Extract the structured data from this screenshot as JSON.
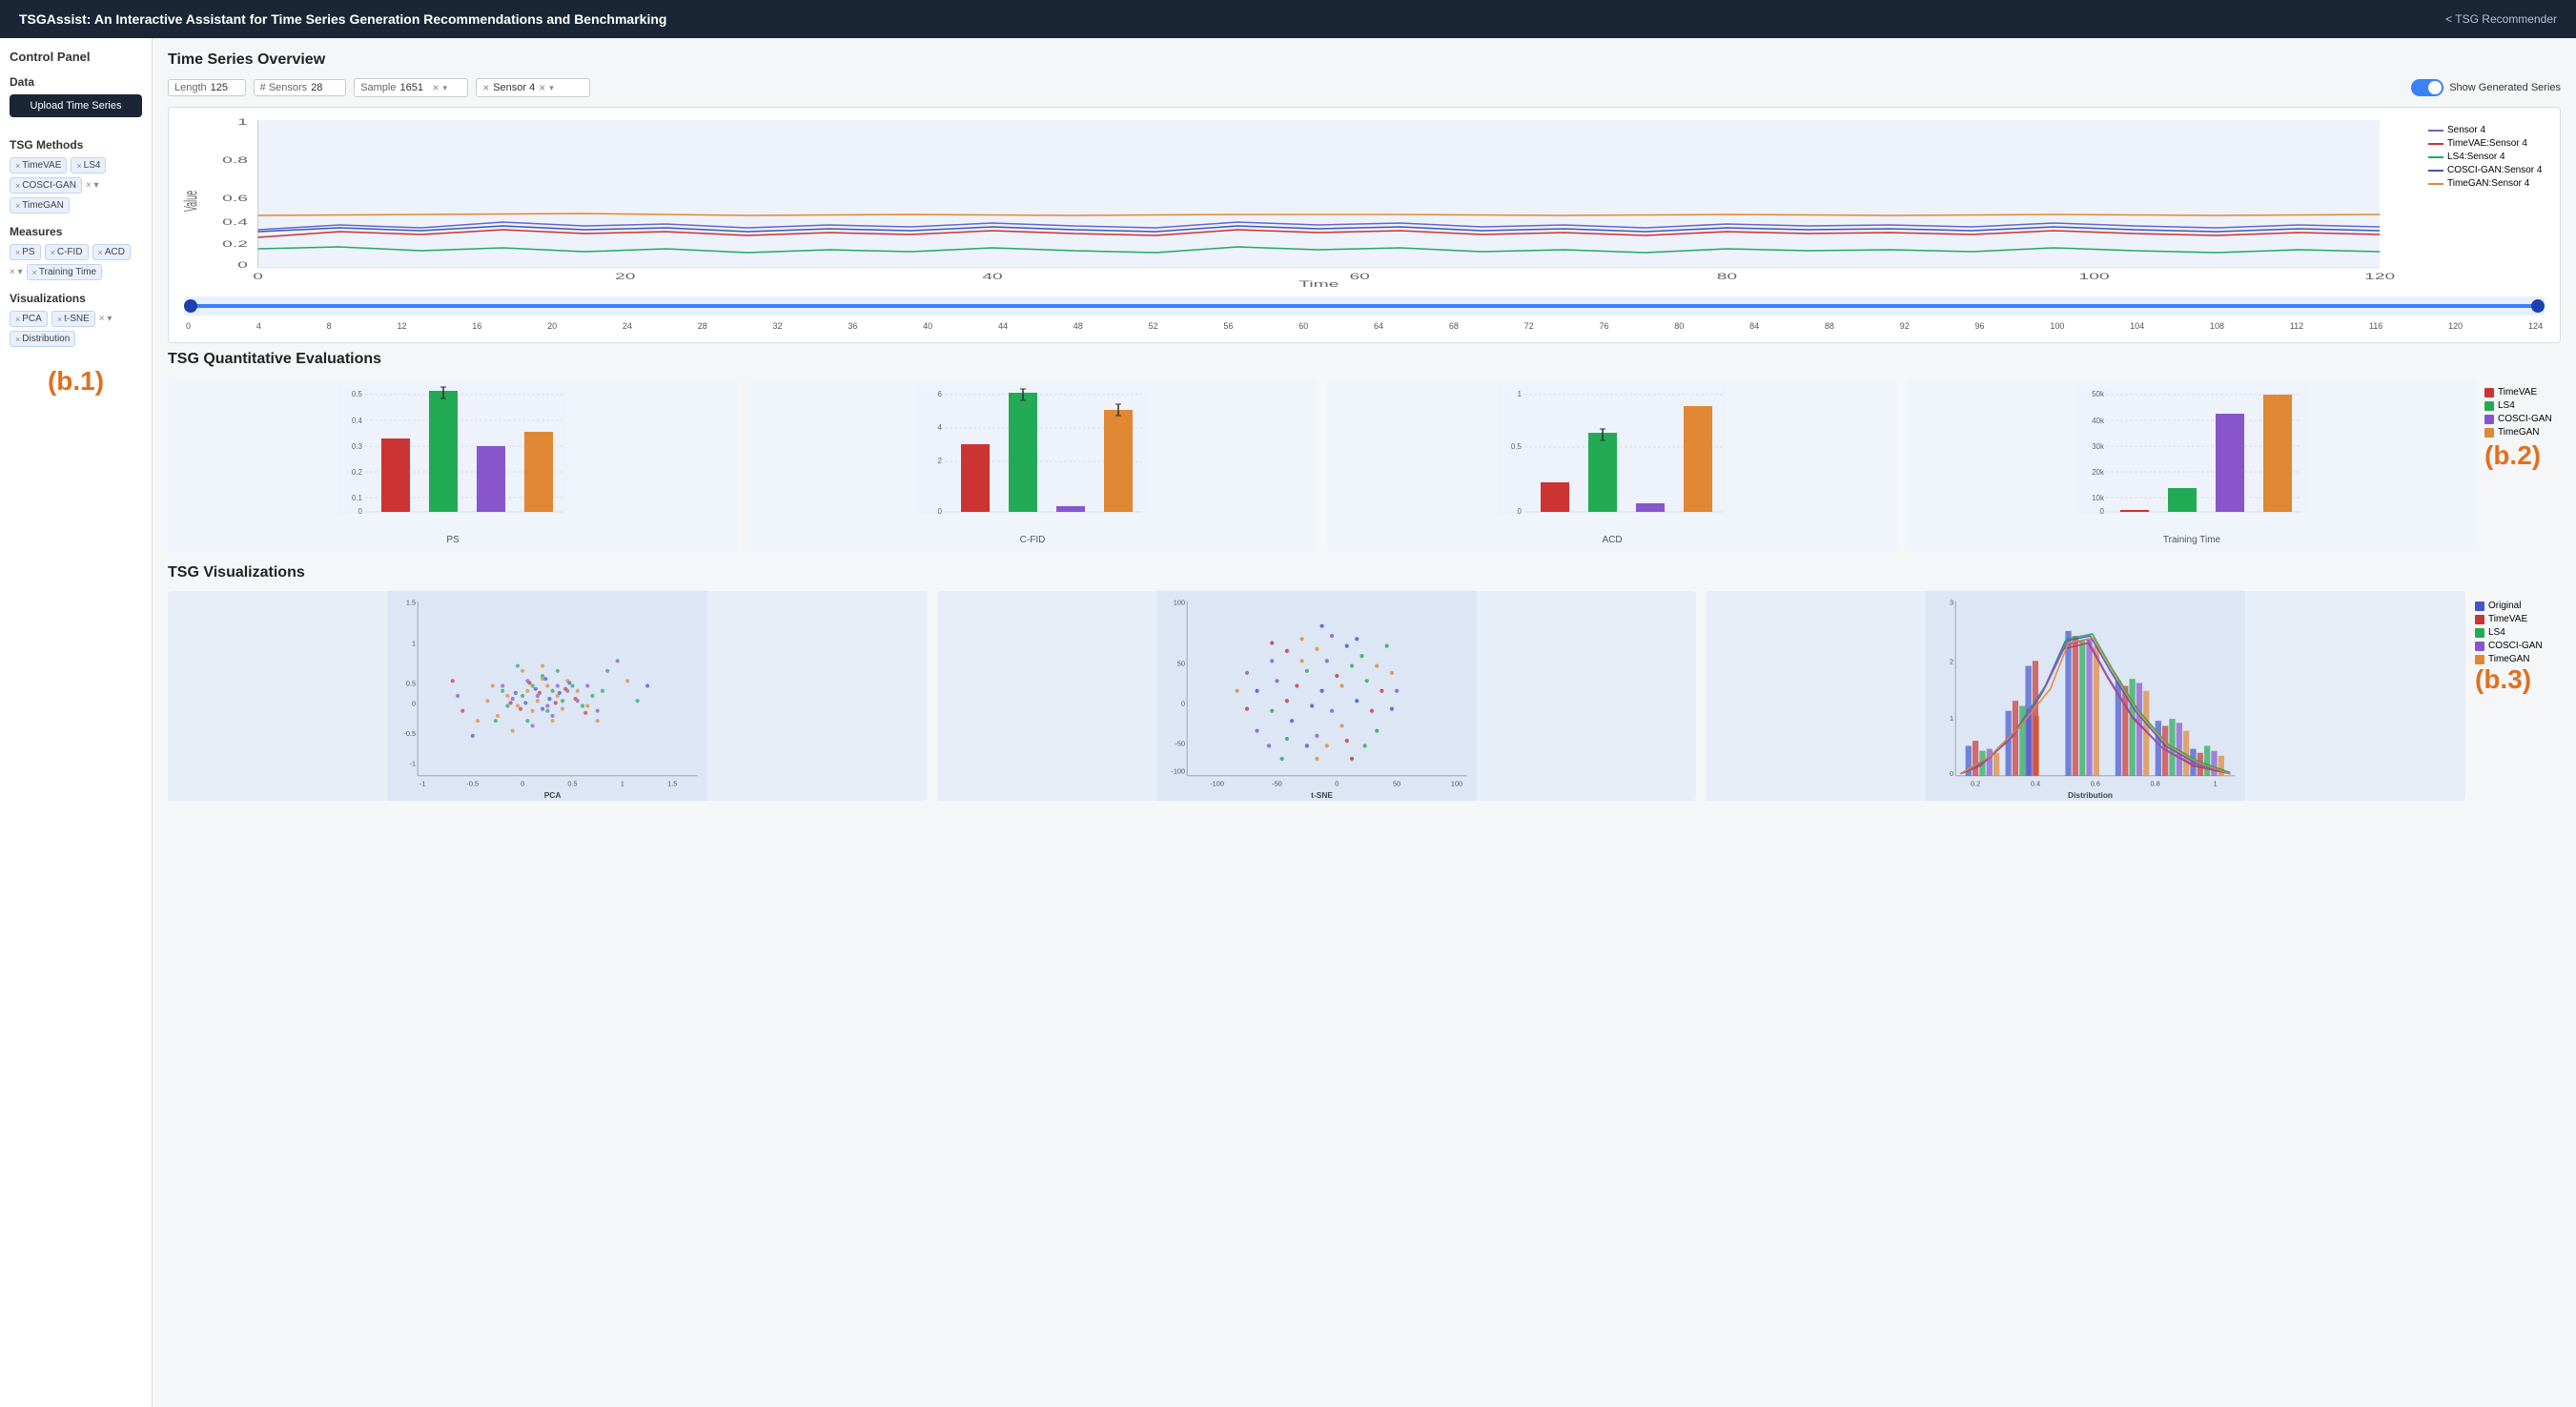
{
  "header": {
    "title": "TSGAssist: An Interactive Assistant for Time Series Generation Recommendations and Benchmarking",
    "link": "< TSG Recommender"
  },
  "sidebar": {
    "title": "Control Panel",
    "data_label": "Data",
    "upload_btn": "Upload Time Series",
    "tsg_methods_label": "TSG Methods",
    "methods": [
      "TimeVAE",
      "LS4",
      "COSCI-GAN",
      "TimeGAN"
    ],
    "measures_label": "Measures",
    "measures": [
      "PS",
      "C-FID",
      "ACD",
      "Training Time"
    ],
    "visualizations_label": "Visualizations",
    "visualizations": [
      "PCA",
      "t-SNE",
      "Distribution"
    ],
    "b1_label": "(b.1)"
  },
  "overview": {
    "title": "Time Series Overview",
    "length_label": "Length",
    "length_value": "125",
    "sensors_label": "# Sensors",
    "sensors_value": "28",
    "sample_label": "Sample",
    "sample_value": "1651",
    "sensor_label": "Sensor 4",
    "toggle_label": "Show Generated Series",
    "slider_ticks": [
      "0",
      "4",
      "8",
      "12",
      "16",
      "20",
      "24",
      "28",
      "32",
      "36",
      "40",
      "44",
      "48",
      "52",
      "56",
      "60",
      "64",
      "68",
      "72",
      "76",
      "80",
      "84",
      "88",
      "92",
      "96",
      "100",
      "104",
      "108",
      "112",
      "116",
      "120",
      "124"
    ],
    "legend": [
      {
        "color": "#6666cc",
        "label": "Sensor 4"
      },
      {
        "color": "#cc3333",
        "label": "TimeVAE:Sensor 4"
      },
      {
        "color": "#22aa66",
        "label": "LS4:Sensor 4"
      },
      {
        "color": "#4455bb",
        "label": "COSCI-GAN:Sensor 4"
      },
      {
        "color": "#e08833",
        "label": "TimeGAN:Sensor 4"
      }
    ]
  },
  "quantitative": {
    "title": "TSG Quantitative Evaluations",
    "charts": [
      {
        "title": "PS",
        "ymax": 0.5
      },
      {
        "title": "C-FID",
        "ymax": 7
      },
      {
        "title": "ACD",
        "ymax": 1.5
      },
      {
        "title": "Training Time",
        "ymax": 50000
      }
    ],
    "legend": [
      {
        "color": "#cc3333",
        "label": "TimeVAE"
      },
      {
        "color": "#22aa55",
        "label": "LS4"
      },
      {
        "color": "#8855cc",
        "label": "COSCI-GAN"
      },
      {
        "color": "#e08833",
        "label": "TimeGAN"
      }
    ],
    "b2_label": "(b.2)"
  },
  "visualizations": {
    "title": "TSG Visualizations",
    "charts": [
      "PCA",
      "t-SNE",
      "Distribution"
    ],
    "legend": [
      {
        "color": "#4455cc",
        "label": "Original"
      },
      {
        "color": "#cc3333",
        "label": "TimeVAE"
      },
      {
        "color": "#22aa55",
        "label": "LS4"
      },
      {
        "color": "#8855cc",
        "label": "COSCI-GAN"
      },
      {
        "color": "#e08833",
        "label": "TimeGAN"
      }
    ],
    "b3_label": "(b.3)"
  }
}
